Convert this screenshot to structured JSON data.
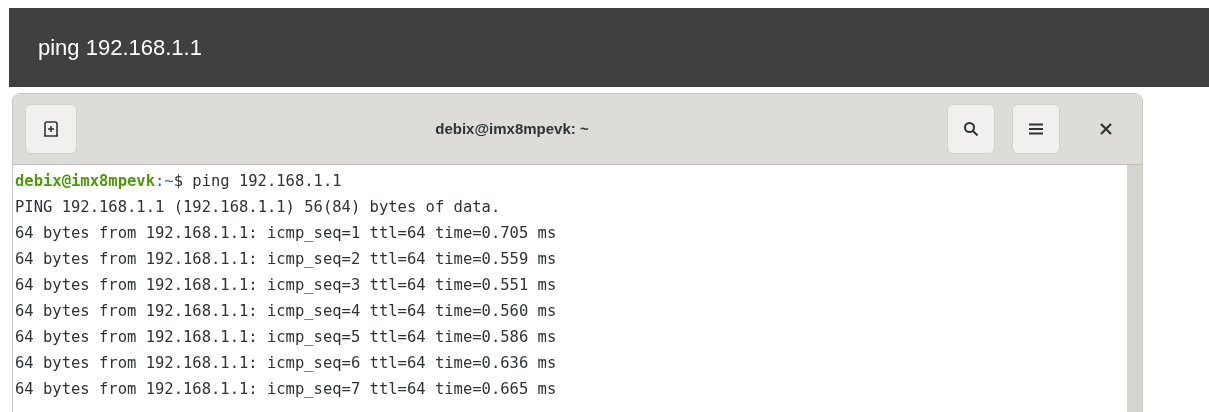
{
  "banner": {
    "text": "ping 192.168.1.1"
  },
  "window": {
    "title": "debix@imx8mpevk: ~"
  },
  "terminal": {
    "prompt": {
      "user_host": "debix@imx8mpevk",
      "path": ":~",
      "symbol": "$",
      "command": "ping 192.168.1.1"
    },
    "lines": [
      "PING 192.168.1.1 (192.168.1.1) 56(84) bytes of data.",
      "64 bytes from 192.168.1.1: icmp_seq=1 ttl=64 time=0.705 ms",
      "64 bytes from 192.168.1.1: icmp_seq=2 ttl=64 time=0.559 ms",
      "64 bytes from 192.168.1.1: icmp_seq=3 ttl=64 time=0.551 ms",
      "64 bytes from 192.168.1.1: icmp_seq=4 ttl=64 time=0.560 ms",
      "64 bytes from 192.168.1.1: icmp_seq=5 ttl=64 time=0.586 ms",
      "64 bytes from 192.168.1.1: icmp_seq=6 ttl=64 time=0.636 ms",
      "64 bytes from 192.168.1.1: icmp_seq=7 ttl=64 time=0.665 ms"
    ]
  }
}
